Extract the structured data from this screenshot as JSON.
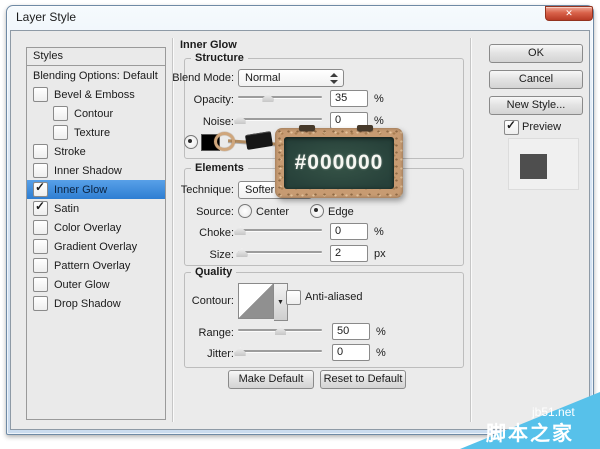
{
  "window": {
    "title": "Layer Style"
  },
  "icons": {
    "close": "✕",
    "dropdown_small": "▼"
  },
  "sidebar": {
    "header": "Styles",
    "blending": "Blending Options: Default",
    "items": [
      {
        "label": "Bevel & Emboss",
        "check": ""
      },
      {
        "label": "Contour",
        "check": ""
      },
      {
        "label": "Texture",
        "check": ""
      },
      {
        "label": "Stroke",
        "check": ""
      },
      {
        "label": "Inner Shadow",
        "check": ""
      },
      {
        "label": "Inner Glow",
        "check": "✓"
      },
      {
        "label": "Satin",
        "check": "✓"
      },
      {
        "label": "Color Overlay",
        "check": ""
      },
      {
        "label": "Gradient Overlay",
        "check": ""
      },
      {
        "label": "Pattern Overlay",
        "check": ""
      },
      {
        "label": "Outer Glow",
        "check": ""
      },
      {
        "label": "Drop Shadow",
        "check": ""
      }
    ]
  },
  "main": {
    "title": "Inner Glow",
    "structure": {
      "legend": "Structure",
      "blend_mode_label": "Blend Mode:",
      "blend_mode_value": "Normal",
      "opacity_label": "Opacity:",
      "opacity_value": "35",
      "opacity_unit": "%",
      "noise_label": "Noise:",
      "noise_value": "0",
      "noise_unit": "%"
    },
    "elements": {
      "legend": "Elements",
      "technique_label": "Technique:",
      "technique_value": "Softer",
      "source_label": "Source:",
      "source_center": "Center",
      "source_edge": "Edge",
      "choke_label": "Choke:",
      "choke_value": "0",
      "choke_unit": "%",
      "size_label": "Size:",
      "size_value": "2",
      "size_unit": "px"
    },
    "quality": {
      "legend": "Quality",
      "contour_label": "Contour:",
      "antialiased_label": "Anti-aliased",
      "range_label": "Range:",
      "range_value": "50",
      "range_unit": "%",
      "jitter_label": "Jitter:",
      "jitter_value": "0",
      "jitter_unit": "%"
    },
    "footer_buttons": {
      "make_default": "Make Default",
      "reset_default": "Reset to Default"
    }
  },
  "actions": {
    "ok": "OK",
    "cancel": "Cancel",
    "new_style": "New Style...",
    "preview_label": "Preview",
    "preview_check": "✓"
  },
  "sliders": {
    "opacity": 35,
    "noise": 2,
    "choke": 2,
    "size": 4,
    "range": 50,
    "jitter": 2
  },
  "overlay": {
    "color_hex_label": "#000000"
  },
  "watermark": {
    "line1": "jb51.net",
    "line2": "脚本之家"
  },
  "colors": {
    "selection_blue": "#3e8ede",
    "watermark_blue": "#57c1ea",
    "glow_color": "#000000",
    "preview_swatch_gray": "#4e4e4e",
    "close_button_red": "#c8473a",
    "board_green": "#2c463d",
    "frame_tan": "#c79b72"
  }
}
